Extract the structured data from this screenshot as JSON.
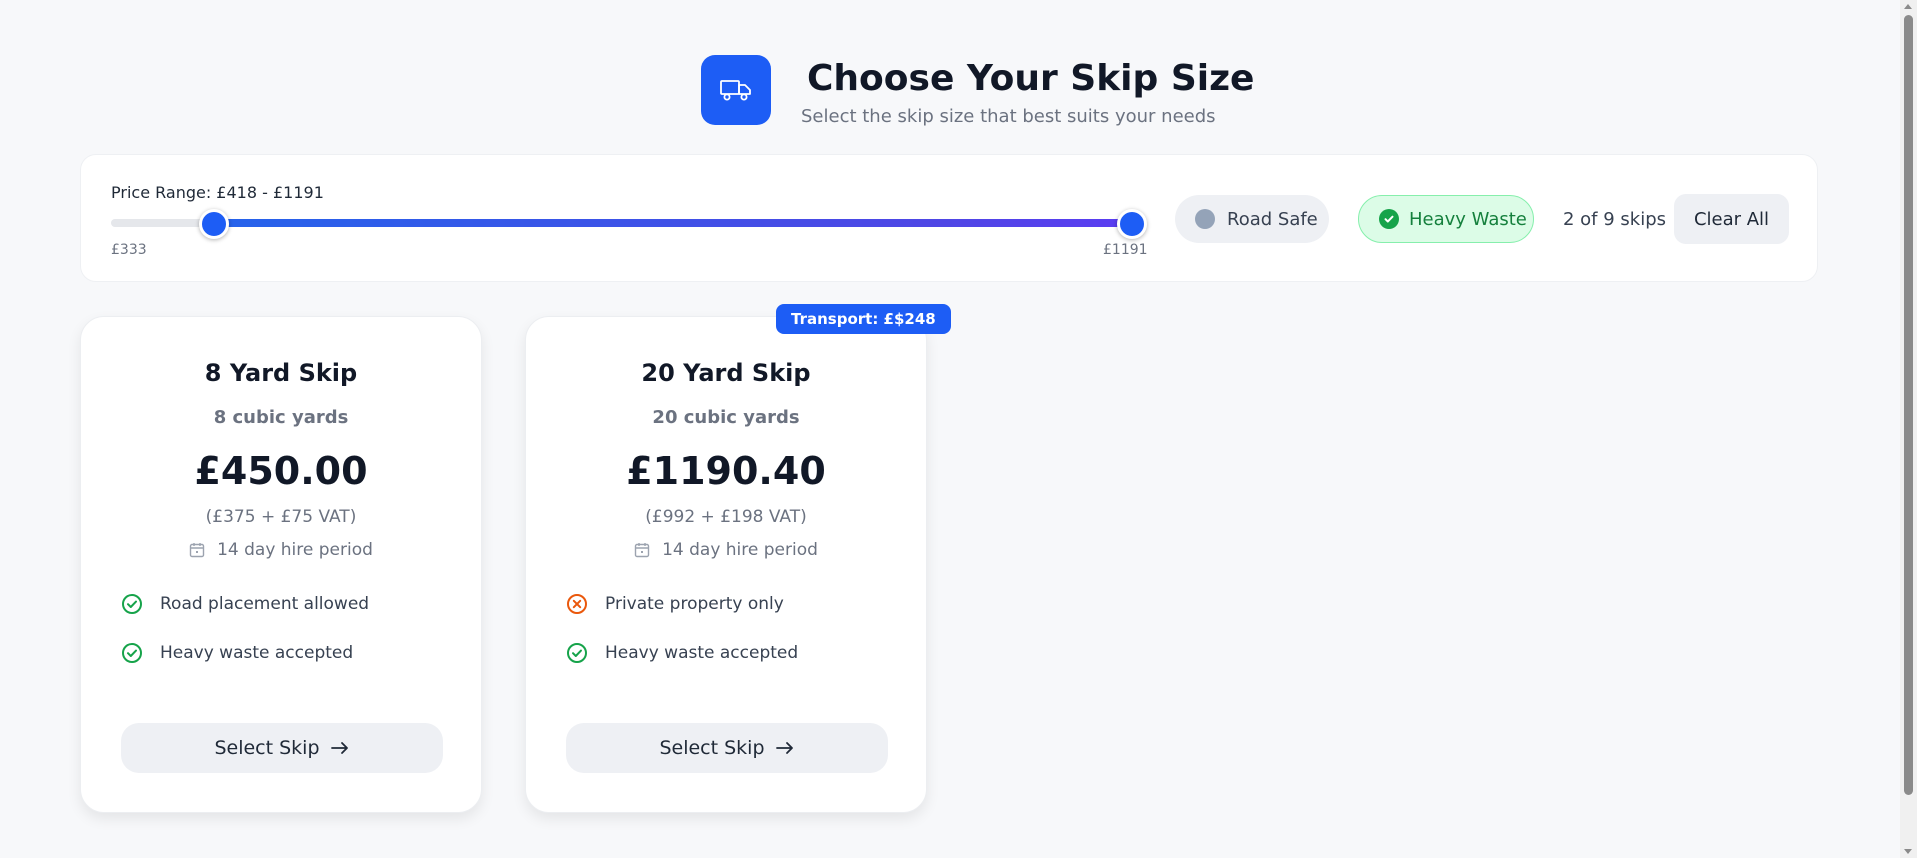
{
  "header": {
    "icon": "truck-icon",
    "title": "Choose Your Skip Size",
    "subtitle": "Select the skip size that best suits your needs"
  },
  "filters": {
    "price_label": "Price Range: £418 - £1191",
    "slider": {
      "min": 333,
      "max": 1191,
      "low": 418,
      "high": 1191,
      "min_label": "£333",
      "max_label": "£1191"
    },
    "road_safe": {
      "label": "Road Safe",
      "active": false
    },
    "heavy_waste": {
      "label": "Heavy Waste",
      "active": true
    },
    "count": "2 of 9 skips",
    "clear_label": "Clear All"
  },
  "cards": [
    {
      "name": "8 Yard Skip",
      "volume": "8 cubic yards",
      "price": "£450.00",
      "breakdown": "(£375 + £75 VAT)",
      "hire": "14 day hire period",
      "features": [
        {
          "text": "Road placement allowed",
          "status": "yes"
        },
        {
          "text": "Heavy waste accepted",
          "status": "yes"
        }
      ],
      "button": "Select Skip"
    },
    {
      "name": "20 Yard Skip",
      "volume": "20 cubic yards",
      "price": "£1190.40",
      "breakdown": "(£992 + £198 VAT)",
      "hire": "14 day hire period",
      "badge": "Transport: £$248",
      "features": [
        {
          "text": "Private property only",
          "status": "no"
        },
        {
          "text": "Heavy waste accepted",
          "status": "yes"
        }
      ],
      "button": "Select Skip"
    }
  ],
  "colors": {
    "accent": "#1d5df5",
    "success": "#16a34a",
    "warning": "#ea580c",
    "muted": "#6b7280"
  }
}
